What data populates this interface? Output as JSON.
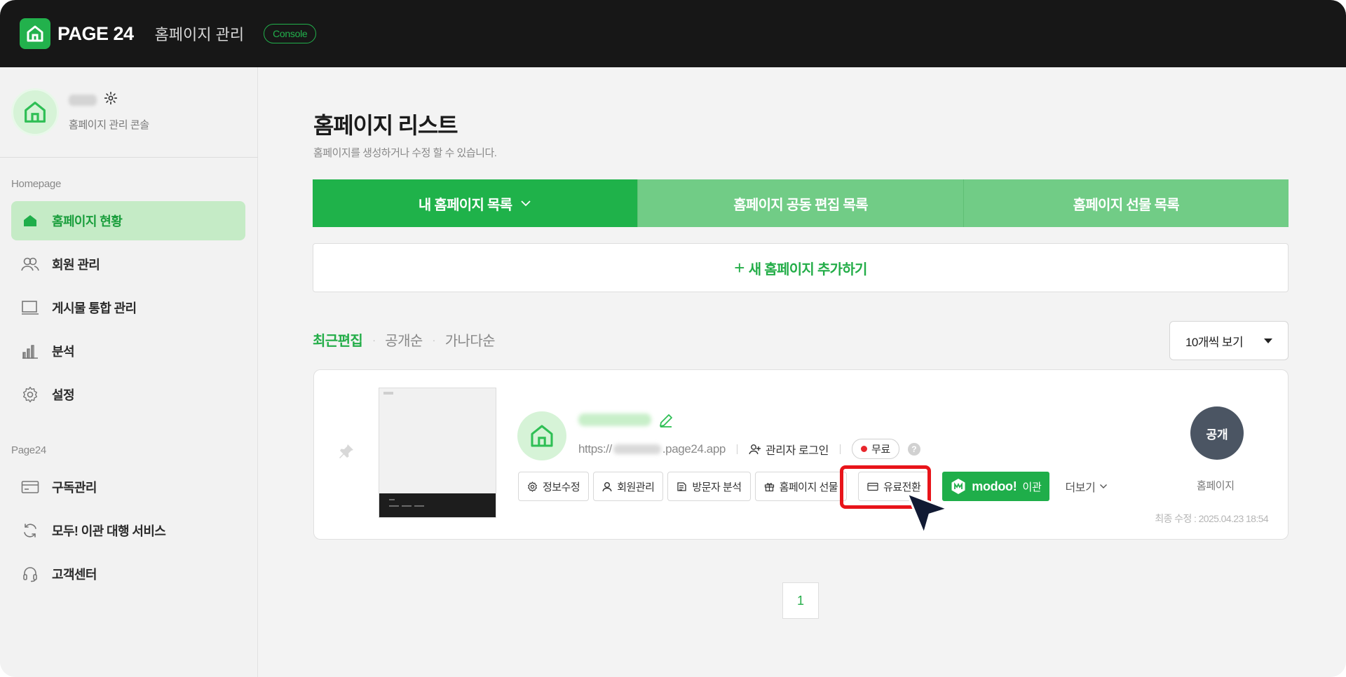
{
  "topbar": {
    "brand": "PAGE 24",
    "app_title": "홈페이지 관리",
    "console_badge": "Console"
  },
  "sidebar": {
    "profile_sub": "홈페이지 관리 콘솔",
    "sections": [
      {
        "label": "Homepage"
      },
      {
        "label": "Page24"
      }
    ],
    "items": [
      {
        "label": "홈페이지 현황",
        "icon": "home-icon",
        "active": true
      },
      {
        "label": "회원 관리",
        "icon": "users-icon"
      },
      {
        "label": "게시물 통합 관리",
        "icon": "monitor-icon"
      },
      {
        "label": "분석",
        "icon": "bar-chart-icon"
      },
      {
        "label": "설정",
        "icon": "gear-icon"
      },
      {
        "label": "구독관리",
        "icon": "card-icon"
      },
      {
        "label": "모두! 이관 대행 서비스",
        "icon": "refresh-icon"
      },
      {
        "label": "고객센터",
        "icon": "headset-icon"
      }
    ]
  },
  "main": {
    "title": "홈페이지 리스트",
    "subtitle": "홈페이지를 생성하거나 수정 할 수 있습니다.",
    "tabs": [
      {
        "label": "내 홈페이지 목록"
      },
      {
        "label": "홈페이지 공동 편집 목록"
      },
      {
        "label": "홈페이지 선물 목록"
      }
    ],
    "add_label": "새 홈페이지 추가하기",
    "sort": {
      "recent": "최근편집",
      "public": "공개순",
      "alpha": "가나다순"
    },
    "per_page": "10개씩 보기",
    "card": {
      "url_prefix": "https://",
      "url_suffix": ".page24.app",
      "admin_login": "관리자 로그인",
      "plan": "무료",
      "help": "?",
      "actions": {
        "info_edit": "정보수정",
        "members": "회원관리",
        "visitor_analysis": "방문자 분석",
        "gift": "홈페이지 선물",
        "upgrade": "유료전환",
        "modoo_brand": "modoo!",
        "modoo_tail": "이관",
        "more": "더보기"
      },
      "public_label": "공개",
      "public_sub": "홈페이지",
      "last_edit": "최종 수정 : 2025.04.23 18:54"
    },
    "pagination": {
      "current": "1"
    }
  },
  "colors": {
    "brand_green": "#1fb24a",
    "tab_inactive": "#71cc86",
    "topbar": "#171717",
    "highlight": "#e8141a",
    "public_button": "#4b5563"
  }
}
